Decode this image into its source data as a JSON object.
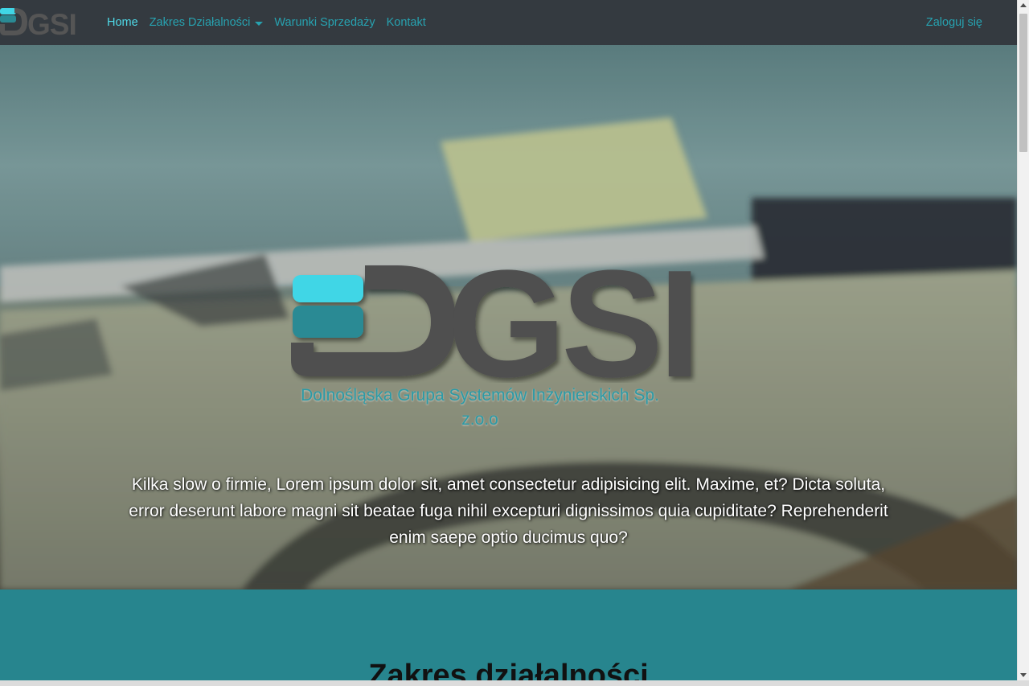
{
  "navbar": {
    "brand": "DGSI",
    "links": [
      {
        "label": "Home",
        "active": true
      },
      {
        "label": "Zakres Działalności",
        "dropdown": true
      },
      {
        "label": "Warunki Sprzedaży"
      },
      {
        "label": "Kontakt"
      }
    ],
    "login_label": "Zaloguj się"
  },
  "hero": {
    "logo_text": "DGSI",
    "company_name": "Dolnośląska Grupa Systemów Inżynierskich Sp. z.o.o",
    "description": "Kilka slow o firmie, Lorem ipsum dolor sit, amet consectetur adipisicing elit. Maxime, et? Dicta soluta, error deserunt labore magni sit beatae fuga nihil excepturi dignissimos quia cupiditate? Reprehenderit enim saepe optio ducimus quo?"
  },
  "section": {
    "title": "Zakres działalności"
  },
  "colors": {
    "navbar_bg": "#343a40",
    "link": "#27a2b0",
    "link_active": "#4fdbe9",
    "section_bg": "#27858e",
    "logo_gray": "#4f4f4f",
    "logo_cyan": "#40d6e6",
    "logo_teal": "#2a8a94"
  }
}
